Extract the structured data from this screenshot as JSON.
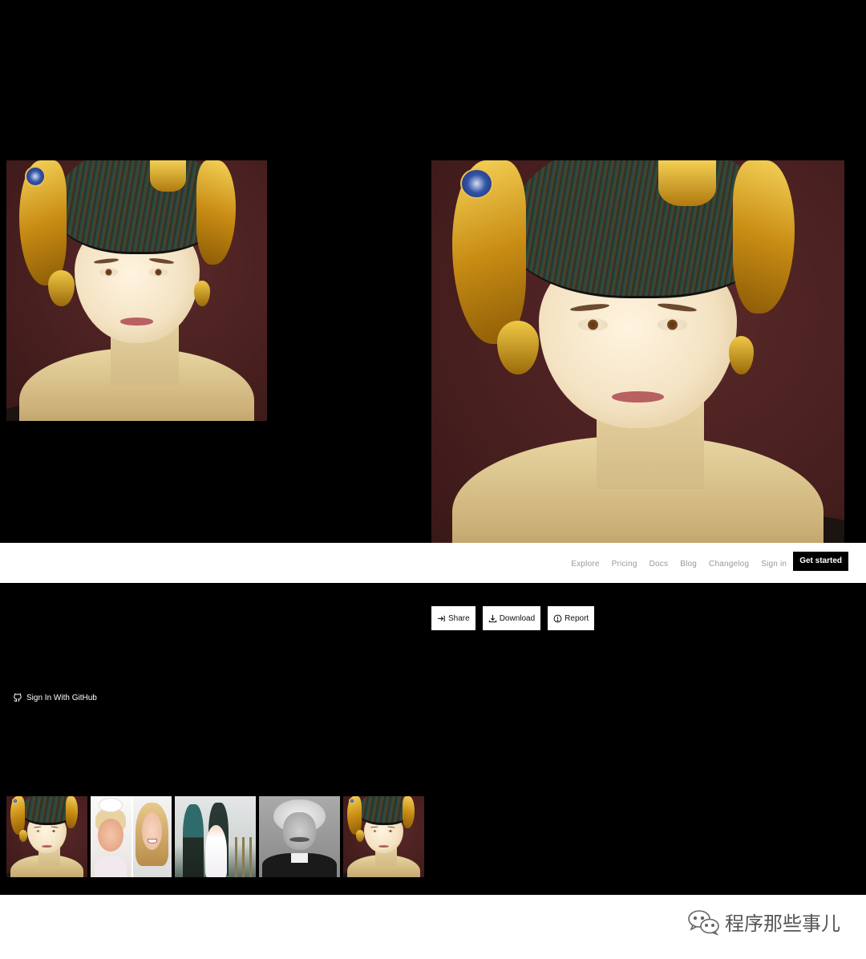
{
  "nav": {
    "links": [
      "Explore",
      "Pricing",
      "Docs",
      "Blog",
      "Changelog",
      "Sign in"
    ],
    "cta": "Get started"
  },
  "actions": {
    "share": "Share",
    "download": "Download",
    "report": "Report"
  },
  "github": {
    "label": "Sign In With GitHub"
  },
  "images": {
    "input_alt": "input-portrait-image",
    "output_alt": "restored-portrait-image"
  },
  "thumbnails": [
    "portrait",
    "children",
    "family",
    "einstein",
    "portrait"
  ],
  "watermark": {
    "text": "程序那些事儿"
  },
  "colors": {
    "background": "#000000",
    "bar": "#ffffff",
    "cta_bg": "#000000",
    "portrait_bg": "#4a2020"
  }
}
